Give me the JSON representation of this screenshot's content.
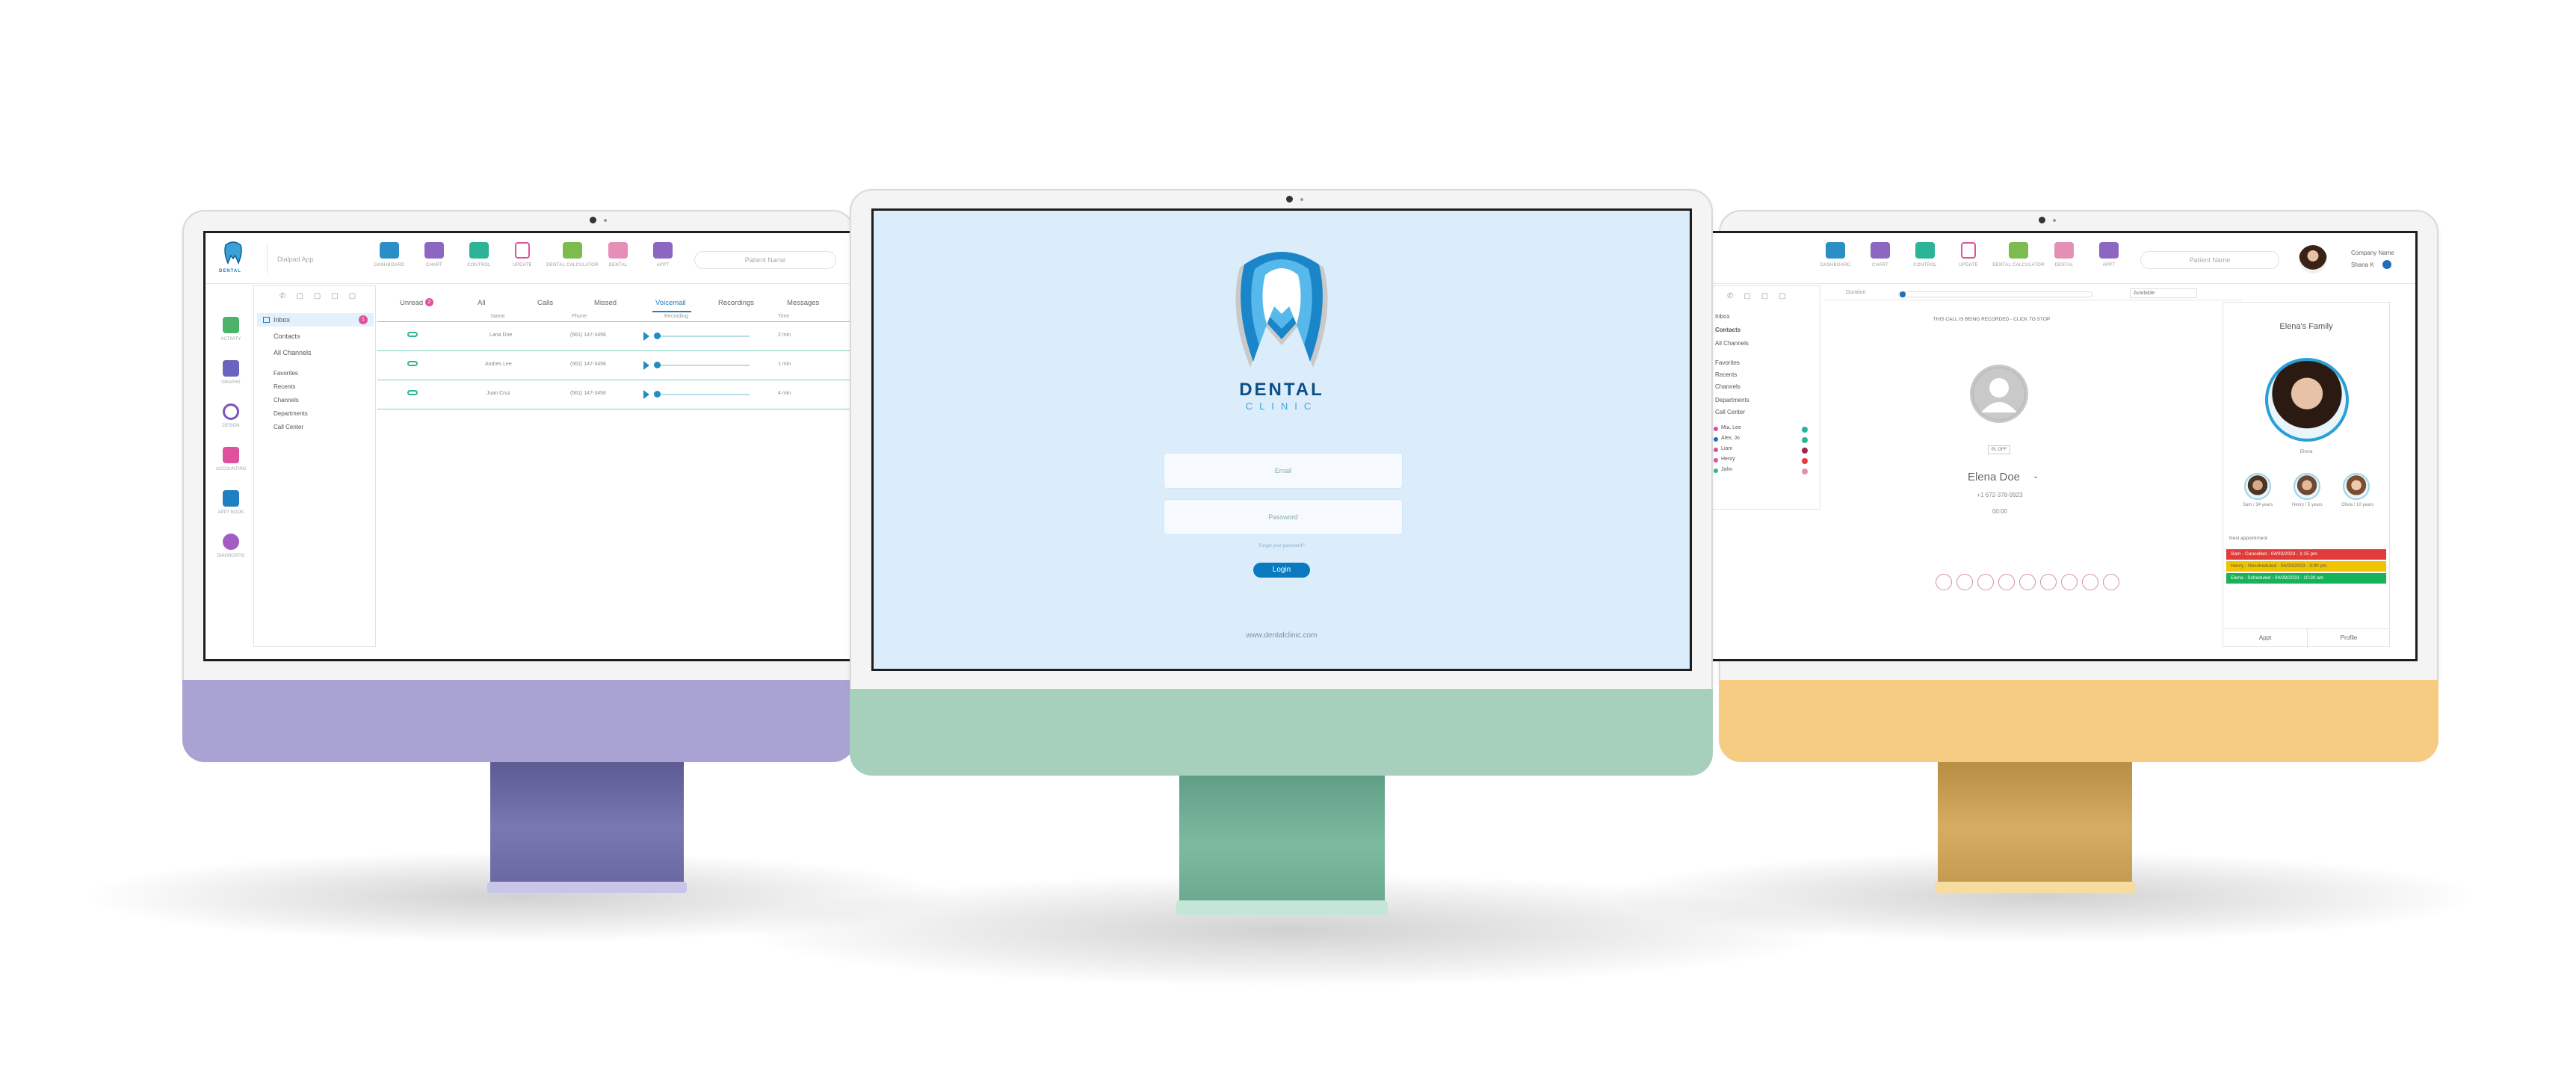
{
  "colors": {
    "left_chin": "#a9a3d4",
    "left_neck": "#6d6ba4",
    "center_chin": "#a6cfbc",
    "center_neck": "#69ab92",
    "right_chin": "#f5cc82",
    "right_neck": "#c9a055",
    "accent_blue": "#0b79c0",
    "teal": "#2cb496",
    "pink": "#e0519d"
  },
  "left_app": {
    "logo_label": "DENTAL",
    "search_placeholder": "Dialpad App",
    "toolbar": [
      "DASHBOARD",
      "CHART",
      "CONTROL",
      "UPDATE",
      "DENTAL CALCULATOR",
      "DENTAL",
      "APPT"
    ],
    "patient_search": "Patient Name",
    "sidebar": [
      "ACTIVITY",
      "GRAPHS",
      "DESIGN",
      "ACCOUNTING",
      "APPT BOOK",
      "DIAGNOSTIC"
    ],
    "nav": {
      "inbox": "Inbox",
      "inbox_badge": "1",
      "contacts": "Contacts",
      "all_channels": "All Channels",
      "groups": [
        "Favorites",
        "Recents",
        "Channels",
        "Departments",
        "Call Center"
      ]
    },
    "tabs": [
      "Unread",
      "All",
      "Calls",
      "Missed",
      "Voicemail",
      "Recordings",
      "Messages"
    ],
    "unread_badge": "2",
    "columns": [
      "Name",
      "Phone",
      "Recording",
      "Time"
    ],
    "voicemails": [
      {
        "name": "Lana Doe",
        "phone": "(561) 147-3456",
        "time": "2 min"
      },
      {
        "name": "Andres Lee",
        "phone": "(561) 147-3456",
        "time": "1 min"
      },
      {
        "name": "Juan Cruz",
        "phone": "(561) 147-3456",
        "time": "4 min"
      }
    ]
  },
  "center_app": {
    "brand_top": "DENTAL",
    "brand_bottom": "CLINIC",
    "email_placeholder": "Email",
    "password_placeholder": "Password",
    "forgot": "Forgot your password?",
    "login_button": "Login",
    "website": "www.dentalclinic.com"
  },
  "right_app": {
    "toolbar": [
      "DASHBOARD",
      "CHART",
      "CONTROL",
      "UPDATE",
      "DENTAL CALCULATOR",
      "DENTAL",
      "APPT"
    ],
    "patient_search": "Patient Name",
    "company": "Company Name",
    "user": "Shana K",
    "nav": {
      "inbox": "Inbox",
      "contacts": "Contacts",
      "all_channels": "All Channels",
      "groups": [
        "Favorites",
        "Recents",
        "Channels",
        "Departments",
        "Call Center"
      ],
      "members": [
        {
          "name": "Mia, Lee",
          "color": "#e0519d"
        },
        {
          "name": "Alex, Jo",
          "color": "#2cb496"
        },
        {
          "name": "Liam",
          "color": "#e0519d"
        },
        {
          "name": "Henry",
          "color": "#e0519d"
        },
        {
          "name": "John",
          "color": "#2cb496"
        }
      ]
    },
    "filter_left": "Duration",
    "filter_right": "Available",
    "recording_banner": "THIS CALL IS BEING RECORDED - CLICK TO STOP",
    "call_status": "PL OFF",
    "caller_name": "Elena Doe",
    "caller_phone": "+1 672-378-9923",
    "call_timer": "00:00",
    "family": {
      "title": "Elena's Family",
      "main_age": "Elena",
      "members": [
        {
          "label": "Sam / 34 years"
        },
        {
          "label": "Henry / 5 years"
        },
        {
          "label": "Olivia / 10 years"
        }
      ],
      "next_appt_label": "Next appointment",
      "appointments": [
        {
          "text": "Sam - Cancelled - 04/03/2023 - 1:15 pm",
          "color": "#e23b3b"
        },
        {
          "text": "Henry - Rescheduled - 04/20/2023 - 3:00 pm",
          "color": "#f0c400"
        },
        {
          "text": "Elena - Scheduled - 04/28/2023 - 10:30 am",
          "color": "#18b25b"
        }
      ],
      "appt_button": "Appt",
      "profile_button": "Profile"
    }
  }
}
